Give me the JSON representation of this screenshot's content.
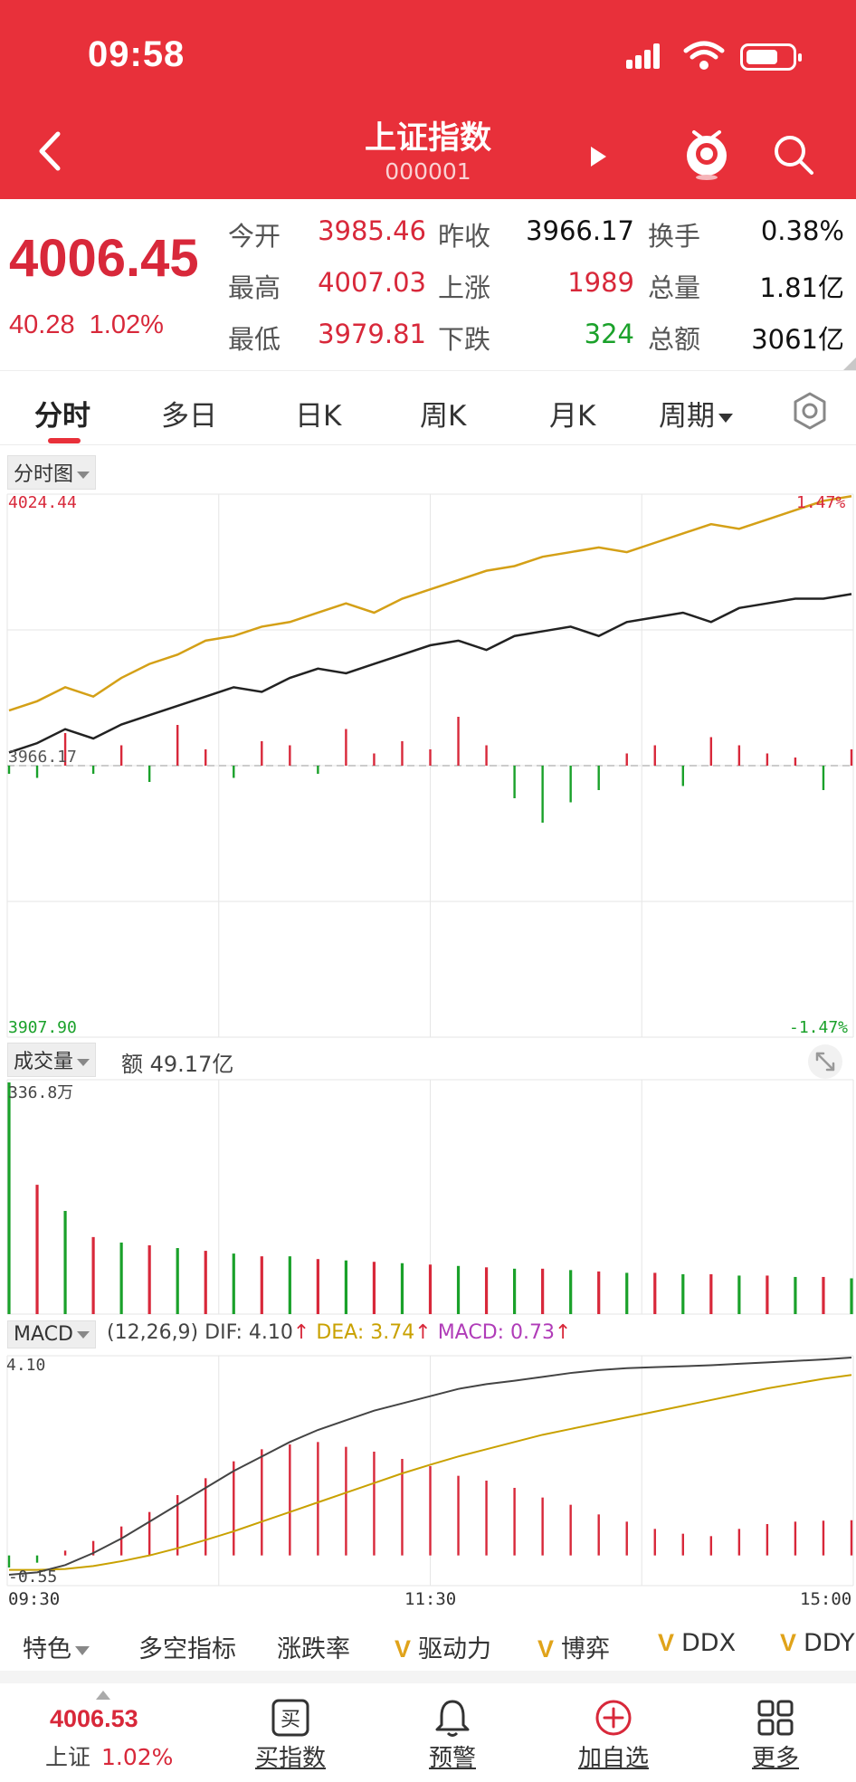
{
  "status_bar": {
    "time": "09:58"
  },
  "header": {
    "title": "上证指数",
    "code": "000001"
  },
  "quote": {
    "price": "4006.45",
    "change": "40.28",
    "change_pct": "1.02%",
    "fields": [
      {
        "label": "今开",
        "value": "3985.46",
        "color": "#d8283a"
      },
      {
        "label": "昨收",
        "value": "3966.17",
        "color": "#111111"
      },
      {
        "label": "换手",
        "value": "0.38%",
        "color": "#111111"
      },
      {
        "label": "最高",
        "value": "4007.03",
        "color": "#d8283a"
      },
      {
        "label": "上涨",
        "value": "1989",
        "color": "#d8283a"
      },
      {
        "label": "总量",
        "value": "1.81亿",
        "color": "#111111"
      },
      {
        "label": "最低",
        "value": "3979.81",
        "color": "#d8283a"
      },
      {
        "label": "下跌",
        "value": "324",
        "color": "#1aa12a"
      },
      {
        "label": "总额",
        "value": "3061亿",
        "color": "#111111"
      }
    ]
  },
  "tabs": [
    {
      "label": "分时",
      "active": true
    },
    {
      "label": "多日"
    },
    {
      "label": "日K"
    },
    {
      "label": "周K"
    },
    {
      "label": "月K"
    },
    {
      "label": "周期"
    }
  ],
  "panels": {
    "price_selector": "分时图",
    "volume_selector": "成交量",
    "volume_amount": "额 49.17亿",
    "macd_selector": "MACD",
    "macd_params": "(12,26,9)",
    "dif": "DIF: 4.10",
    "dea": "DEA: 3.74",
    "macd": "MACD: 0.73"
  },
  "chart_data": [
    {
      "type": "line",
      "name": "分时图",
      "y_top_label": "4024.44",
      "y_bottom_label": "3907.90",
      "y_mid_label": "3966.17",
      "pct_top_label": "1.47%",
      "pct_bottom_label": "-1.47%",
      "ylim": [
        3907.9,
        4024.44
      ],
      "prev_close": 3966.17,
      "x_ticks": [
        "09:30",
        "11:30",
        "15:00"
      ],
      "series": [
        {
          "color": "#d4a017",
          "values": [
            3978,
            3980,
            3983,
            3981,
            3985,
            3988,
            3990,
            3993,
            3994,
            3996,
            3997,
            3999,
            4001,
            3999,
            4002,
            4004,
            4006,
            4008,
            4009,
            4011,
            4012,
            4013,
            4012,
            4014,
            4016,
            4018,
            4017,
            4019,
            4021,
            4023,
            4024
          ]
        },
        {
          "color": "#222222",
          "values": [
            3969,
            3971,
            3974,
            3972,
            3975,
            3977,
            3979,
            3981,
            3983,
            3982,
            3985,
            3987,
            3986,
            3988,
            3990,
            3992,
            3993,
            3991,
            3994,
            3995,
            3996,
            3994,
            3997,
            3998,
            3999,
            3997,
            4000,
            4001,
            4002,
            4002,
            4003
          ]
        }
      ],
      "bars": [
        -2,
        -3,
        8,
        -2,
        5,
        -4,
        10,
        4,
        -3,
        6,
        5,
        -2,
        9,
        3,
        6,
        4,
        12,
        5,
        -8,
        -14,
        -9,
        -6,
        3,
        5,
        -5,
        7,
        5,
        3,
        2,
        -6,
        4
      ]
    },
    {
      "type": "bar",
      "name": "成交量",
      "y_top_label": "336.8万",
      "values": [
        336.8,
        188,
        150,
        112,
        104,
        100,
        96,
        92,
        88,
        84,
        84,
        80,
        78,
        76,
        74,
        72,
        70,
        68,
        66,
        66,
        64,
        62,
        60,
        60,
        58,
        58,
        56,
        56,
        54,
        54,
        52
      ]
    },
    {
      "type": "line",
      "name": "MACD",
      "y_top_label": "4.10",
      "y_bottom_label": "-0.55",
      "ylim": [
        -0.55,
        4.1
      ],
      "dif": [
        -0.4,
        -0.35,
        -0.2,
        0.05,
        0.35,
        0.7,
        1.05,
        1.4,
        1.75,
        2.05,
        2.35,
        2.6,
        2.8,
        3.0,
        3.15,
        3.3,
        3.45,
        3.55,
        3.62,
        3.7,
        3.78,
        3.84,
        3.88,
        3.9,
        3.92,
        3.94,
        3.97,
        4.0,
        4.03,
        4.06,
        4.1
      ],
      "dea": [
        -0.3,
        -0.3,
        -0.28,
        -0.22,
        -0.12,
        0.0,
        0.15,
        0.32,
        0.5,
        0.7,
        0.9,
        1.1,
        1.3,
        1.5,
        1.7,
        1.88,
        2.05,
        2.2,
        2.35,
        2.5,
        2.62,
        2.74,
        2.86,
        2.98,
        3.1,
        3.22,
        3.34,
        3.46,
        3.56,
        3.66,
        3.74
      ],
      "hist": [
        -0.25,
        -0.15,
        0.1,
        0.3,
        0.6,
        0.9,
        1.25,
        1.6,
        1.95,
        2.2,
        2.3,
        2.35,
        2.25,
        2.15,
        2.0,
        1.85,
        1.65,
        1.55,
        1.4,
        1.2,
        1.05,
        0.85,
        0.7,
        0.55,
        0.45,
        0.4,
        0.55,
        0.65,
        0.7,
        0.72,
        0.73
      ]
    }
  ],
  "indicators": [
    {
      "label": "特色",
      "v": false,
      "caret": true
    },
    {
      "label": "多空指标",
      "v": false
    },
    {
      "label": "涨跌率",
      "v": false
    },
    {
      "label": "驱动力",
      "v": true
    },
    {
      "label": "博弈",
      "v": true
    },
    {
      "label": "DDX",
      "v": true
    },
    {
      "label": "DDY",
      "v": true
    }
  ],
  "bottom_bar": {
    "price": "4006.53",
    "name": "上证",
    "pct": "1.02%",
    "items": [
      {
        "label": "买指数",
        "icon": "buy-icon",
        "glyph": "买"
      },
      {
        "label": "预警",
        "icon": "bell-icon"
      },
      {
        "label": "加自选",
        "icon": "add-circle-icon"
      },
      {
        "label": "更多",
        "icon": "grid-icon"
      }
    ]
  },
  "colors": {
    "up": "#d8283a",
    "down": "#1aa12a",
    "header": "#e8303a",
    "avg_line": "#d4a017"
  }
}
